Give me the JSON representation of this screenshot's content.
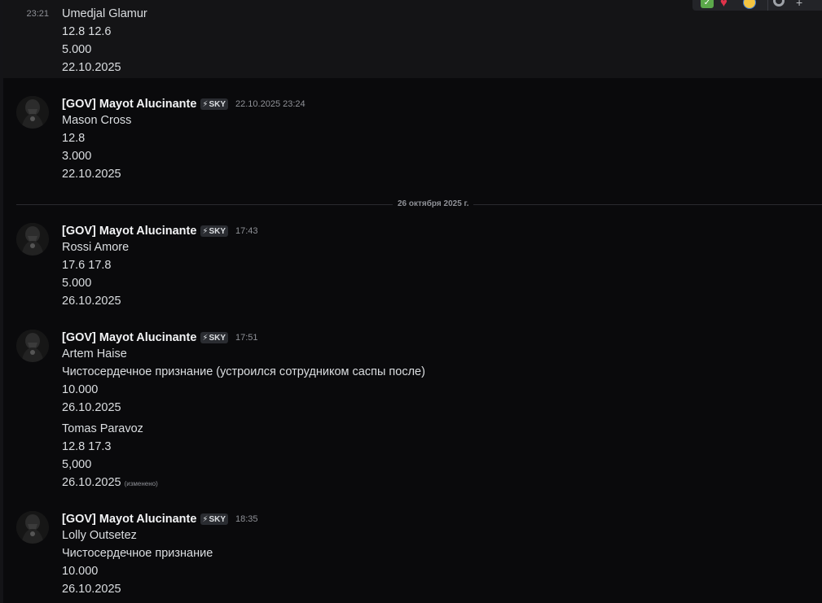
{
  "toolbar": {
    "icons": [
      "check-reaction-icon",
      "heart-reaction-icon",
      "face-emoji-icon",
      "add-reaction-icon",
      "more-options-icon"
    ]
  },
  "divider": {
    "label": "26 октября 2025 г."
  },
  "messages": [
    {
      "time": "23:21",
      "lines": [
        "Umedjal Glamur",
        "12.8 12.6",
        "5.000",
        "22.10.2025"
      ]
    },
    {
      "username": "[GOV] Mayot Alucinante",
      "tag": "SKY",
      "tag_icon": "⚡",
      "timestamp": "22.10.2025 23:24",
      "lines": [
        "Mason Cross",
        "12.8",
        "3.000",
        "22.10.2025"
      ]
    },
    {
      "username": "[GOV] Mayot Alucinante",
      "tag": "SKY",
      "tag_icon": "⚡",
      "timestamp": "17:43",
      "lines": [
        "Rossi Amore",
        "17.6 17.8",
        "5.000",
        "26.10.2025"
      ]
    },
    {
      "username": "[GOV] Mayot Alucinante",
      "tag": "SKY",
      "tag_icon": "⚡",
      "timestamp": "17:51",
      "lines": [
        "Artem Haise",
        "Чистосердечное признание (устроился сотрудником саспы после)",
        "10.000",
        "26.10.2025"
      ]
    },
    {
      "lines": [
        "Tomas Paravoz",
        "12.8 17.3",
        "5,000",
        "26.10.2025"
      ],
      "edited": "(изменено)"
    },
    {
      "username": "[GOV] Mayot Alucinante",
      "tag": "SKY",
      "tag_icon": "⚡",
      "timestamp": "18:35",
      "lines": [
        "Lolly Outsetez",
        "Чистосердечное признание",
        "10.000",
        "26.10.2025"
      ]
    }
  ]
}
